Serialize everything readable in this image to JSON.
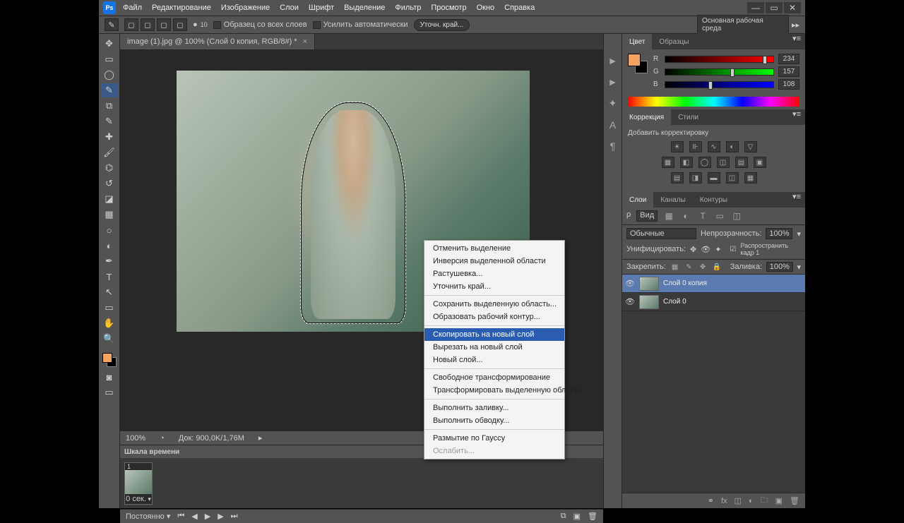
{
  "menus": {
    "file": "Файл",
    "edit": "Редактирование",
    "image": "Изображение",
    "layer": "Слои",
    "type": "Шрифт",
    "select": "Выделение",
    "filter": "Фильтр",
    "view": "Просмотр",
    "window": "Окно",
    "help": "Справка"
  },
  "options": {
    "size": "10",
    "sample_all": "Образец со всех слоев",
    "auto_enhance": "Усилить автоматически",
    "refine": "Уточн. край...",
    "workspace": "Основная рабочая среда"
  },
  "doc": {
    "tab": "image (1).jpg @ 100% (Слой 0 копия, RGB/8#) *",
    "zoom": "100%",
    "docinfo": "Док: 900,0K/1,76M"
  },
  "timeline": {
    "title": "Шкала времени",
    "frame": "1",
    "duration": "0 сек.",
    "loop": "Постоянно"
  },
  "color": {
    "tab1": "Цвет",
    "tab2": "Образцы",
    "r_lbl": "R",
    "g_lbl": "G",
    "b_lbl": "B",
    "r": "234",
    "g": "157",
    "b": "108"
  },
  "corr": {
    "tab1": "Коррекция",
    "tab2": "Стили",
    "title": "Добавить корректировку"
  },
  "layers": {
    "tab1": "Слои",
    "tab2": "Каналы",
    "tab3": "Контуры",
    "kind": "Вид",
    "blend": "Обычные",
    "opacity_lbl": "Непрозрачность:",
    "opacity": "100%",
    "unify": "Унифицировать:",
    "propagate": "Распространить кадр 1",
    "lock": "Закрепить:",
    "fill_lbl": "Заливка:",
    "fill": "100%",
    "layer1": "Слой 0 копия",
    "layer2": "Слой 0"
  },
  "ctx": {
    "deselect": "Отменить выделение",
    "inverse": "Инверсия выделенной области",
    "feather": "Растушевка...",
    "refine": "Уточнить край...",
    "save_sel": "Сохранить выделенную область...",
    "make_path": "Образовать рабочий контур...",
    "copy_layer": "Скопировать на новый слой",
    "cut_layer": "Вырезать на новый слой",
    "new_layer": "Новый слой...",
    "free_tr": "Свободное трансформирование",
    "tr_sel": "Трансформировать выделенную область",
    "fill": "Выполнить заливку...",
    "stroke": "Выполнить обводку...",
    "gauss": "Размытие по Гауссу",
    "fade": "Ослабить..."
  }
}
